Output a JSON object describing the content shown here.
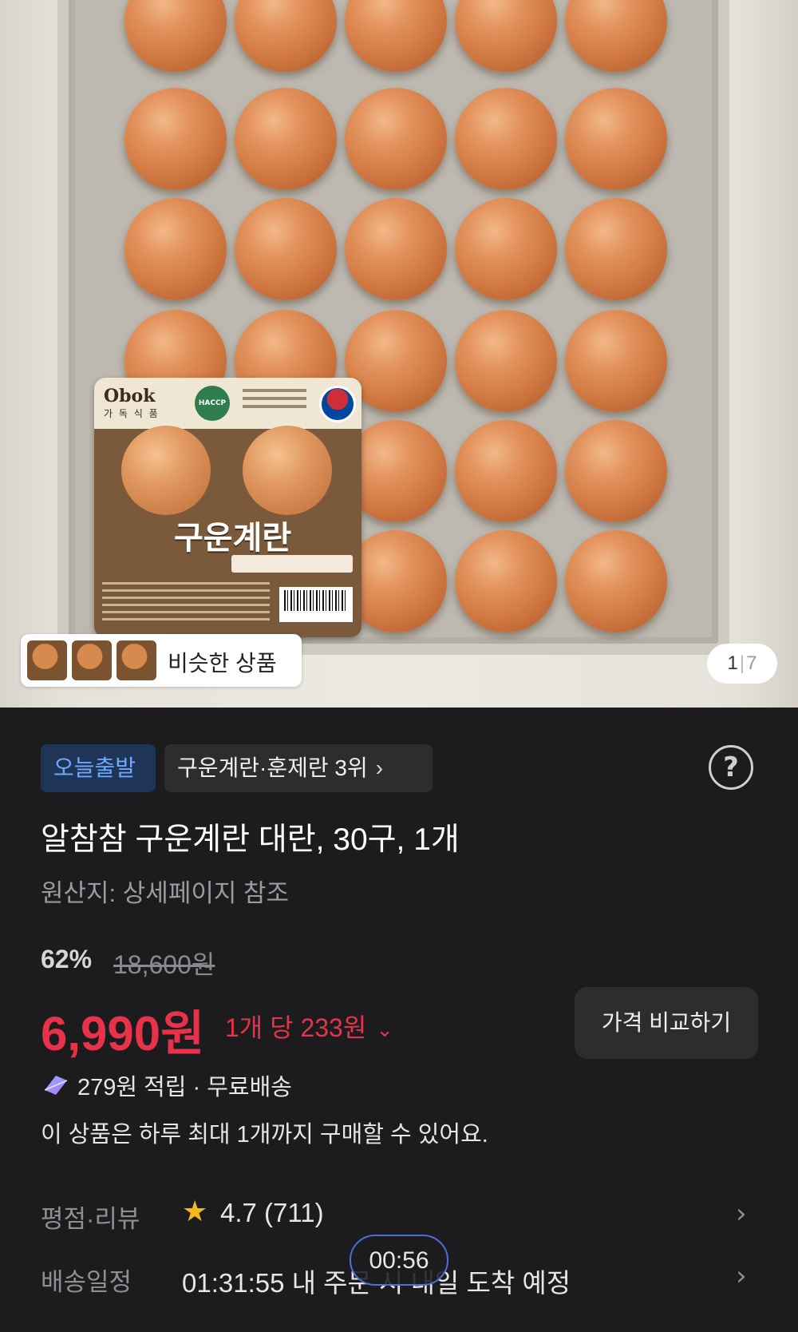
{
  "product_image": {
    "similar_label": "비슷한 상품",
    "pager": {
      "current": "1",
      "total": "7"
    },
    "package_title": "구운계란"
  },
  "badges": {
    "today_shipping": "오늘출발",
    "ranking": "구운계란·훈제란 3위"
  },
  "product": {
    "title": "알참참 구운계란 대란, 30구, 1개",
    "origin": "원산지: 상세페이지 참조"
  },
  "pricing": {
    "discount": "62%",
    "original_price": "18,600원",
    "price": "6,990원",
    "unit_price": "1개 당 233원",
    "compare_button": "가격 비교하기",
    "accent_color": "#e8324a"
  },
  "benefits": {
    "reward": "279원 적립 · 무료배송",
    "purchase_limit": "이 상품은 하루 최대 1개까지 구매할 수 있어요."
  },
  "rating_row": {
    "label": "평점·리뷰",
    "value": "4.7 (711)"
  },
  "shipping_row": {
    "label": "배송일정",
    "value": "01:31:55 내 주문 시 내일 도착 예정"
  },
  "timer": "00:56"
}
